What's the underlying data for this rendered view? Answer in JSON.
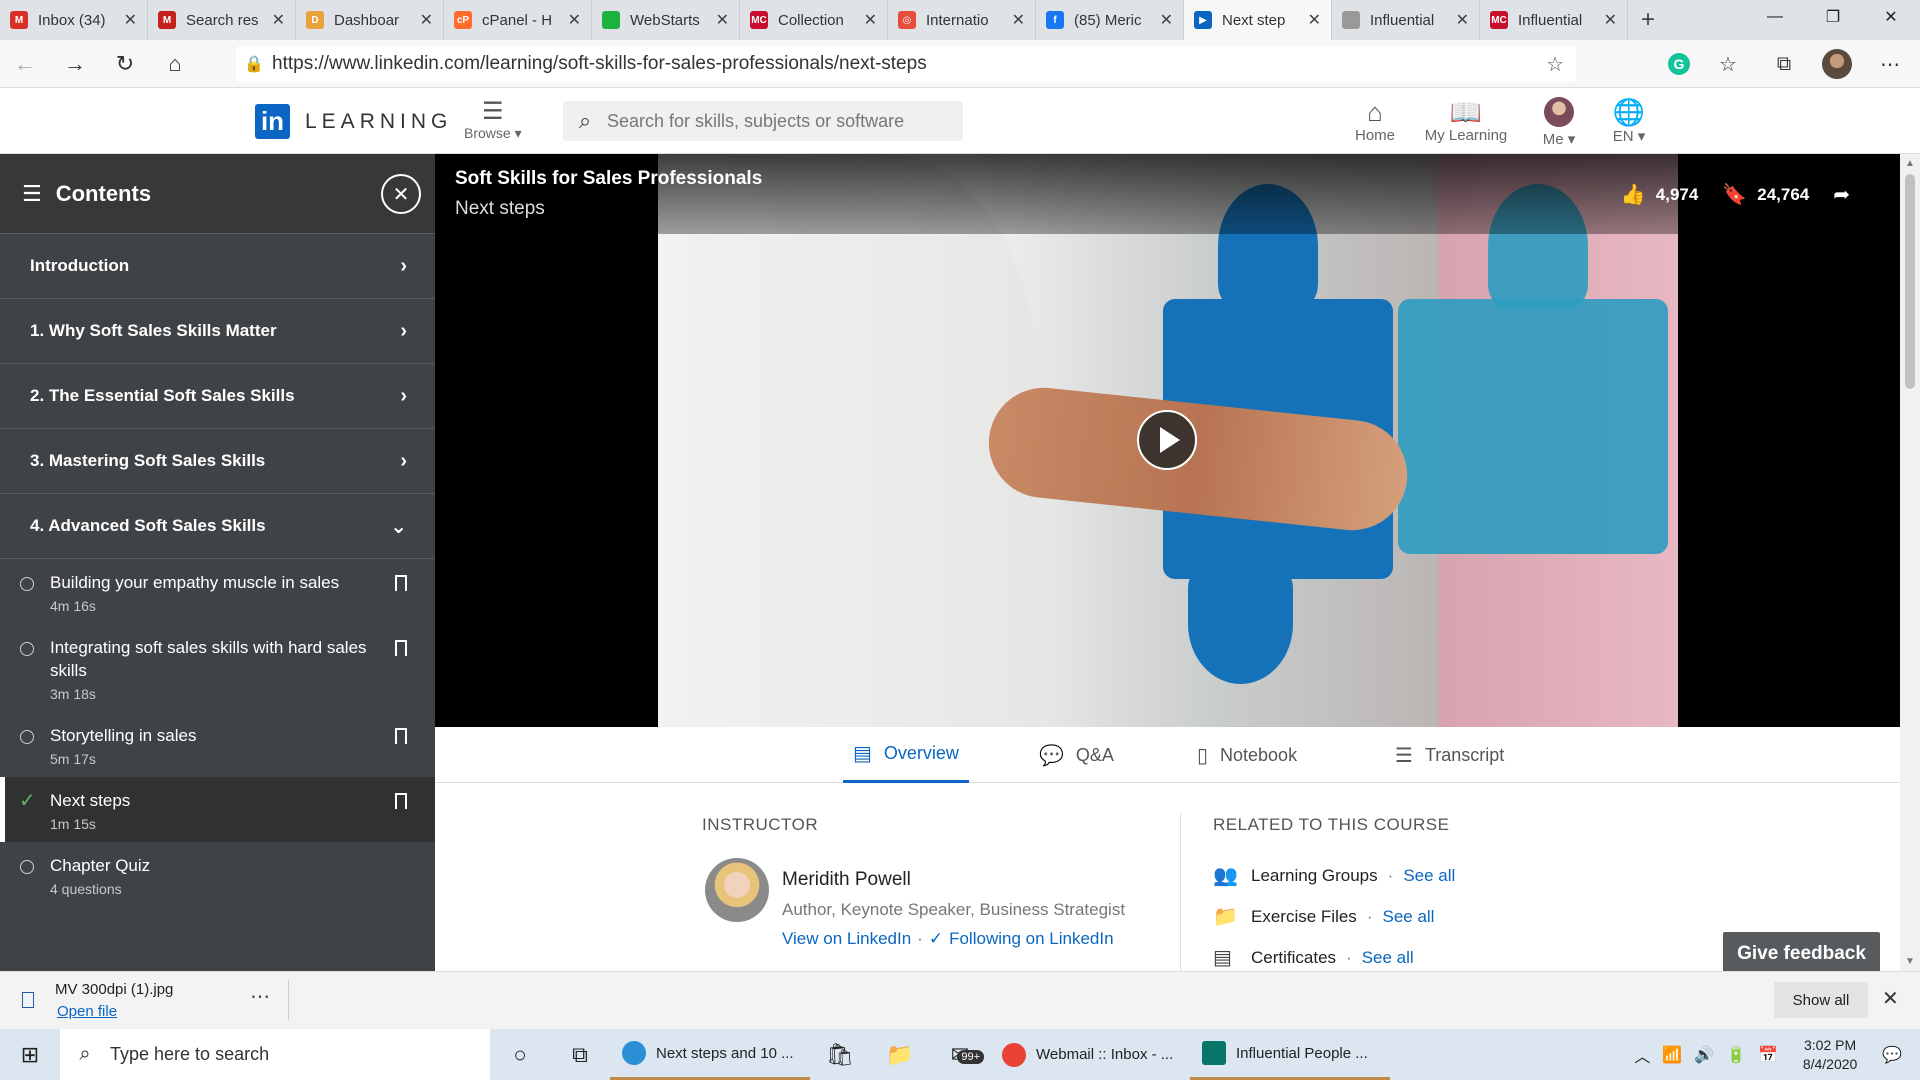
{
  "browser": {
    "tabs": [
      {
        "label": "Inbox (34)",
        "icon": "gmail-icon",
        "color": "#d93025",
        "glyph": "M"
      },
      {
        "label": "Search res",
        "icon": "gmail-100-icon",
        "color": "#c5221f",
        "glyph": "M"
      },
      {
        "label": "Dashboar",
        "icon": "dashboard-icon",
        "color": "#e8a33c",
        "glyph": "D"
      },
      {
        "label": "cPanel - H",
        "icon": "cpanel-icon",
        "color": "#ff6c2c",
        "glyph": "cP"
      },
      {
        "label": "WebStarts",
        "icon": "webstarts-icon",
        "color": "#1bb33d",
        "glyph": ""
      },
      {
        "label": "Collection",
        "icon": "mc-icon",
        "color": "#c8102e",
        "glyph": "MC"
      },
      {
        "label": "Internatio",
        "icon": "target-icon",
        "color": "#e74c3c",
        "glyph": "◎"
      },
      {
        "label": "(85) Meric",
        "icon": "facebook-icon",
        "color": "#1877f2",
        "glyph": "f"
      },
      {
        "label": "Next step",
        "icon": "linkedin-learning-icon",
        "color": "#0a66c2",
        "glyph": "▶"
      },
      {
        "label": "Influential",
        "icon": "document-icon",
        "color": "#999999",
        "glyph": ""
      },
      {
        "label": "Influential",
        "icon": "mc-icon",
        "color": "#c8102e",
        "glyph": "MC"
      }
    ],
    "url": "https://www.linkedin.com/learning/soft-skills-for-sales-professionals/next-steps"
  },
  "header": {
    "logo_mark": "in",
    "logo_text": "LEARNING",
    "browse_label": "Browse",
    "search_placeholder": "Search for skills, subjects or software",
    "nav": {
      "home": "Home",
      "my_learning": "My Learning",
      "me": "Me",
      "lang": "EN"
    }
  },
  "sidebar": {
    "title": "Contents",
    "chapters": [
      {
        "label": "Introduction"
      },
      {
        "label": "1. Why Soft Sales Skills Matter"
      },
      {
        "label": "2. The Essential Soft Sales Skills"
      },
      {
        "label": "3. Mastering Soft Sales Skills"
      },
      {
        "label": "4. Advanced Soft Sales Skills"
      }
    ],
    "lessons": [
      {
        "title": "Building your empathy muscle in sales",
        "duration": "4m 16s"
      },
      {
        "title": "Integrating soft sales skills with hard sales skills",
        "duration": "3m 18s"
      },
      {
        "title": "Storytelling in sales",
        "duration": "5m 17s"
      },
      {
        "title": "Next steps",
        "duration": "1m 15s"
      },
      {
        "title": "Chapter Quiz",
        "duration": "4 questions"
      }
    ]
  },
  "video": {
    "course_title": "Soft Skills for Sales Professionals",
    "lesson_title": "Next steps",
    "likes": "4,974",
    "saves": "24,764"
  },
  "tabs": {
    "overview": "Overview",
    "qa": "Q&A",
    "notebook": "Notebook",
    "transcript": "Transcript"
  },
  "overview": {
    "instructor_heading": "INSTRUCTOR",
    "instructor_name": "Meridith Powell",
    "instructor_role": "Author, Keynote Speaker, Business Strategist",
    "view_linkedin": "View on LinkedIn",
    "following": "Following on LinkedIn",
    "related_heading": "RELATED TO THIS COURSE",
    "related": [
      {
        "label": "Learning Groups",
        "link": "See all"
      },
      {
        "label": "Exercise Files",
        "link": "See all"
      },
      {
        "label": "Certificates",
        "link": "See all"
      }
    ],
    "feedback": "Give feedback"
  },
  "download": {
    "file_name": "MV 300dpi (1).jpg",
    "open": "Open file",
    "show_all": "Show all"
  },
  "taskbar": {
    "search_placeholder": "Type here to search",
    "apps": [
      {
        "label": "Next steps and 10 ...",
        "color": "#2b8fd6"
      },
      {
        "label": "Webmail :: Inbox - ...",
        "color": "#e94235"
      },
      {
        "label": "Influential People ...",
        "color": "#077568"
      }
    ],
    "mail_badge": "99+",
    "time": "3:02 PM",
    "date": "8/4/2020"
  }
}
